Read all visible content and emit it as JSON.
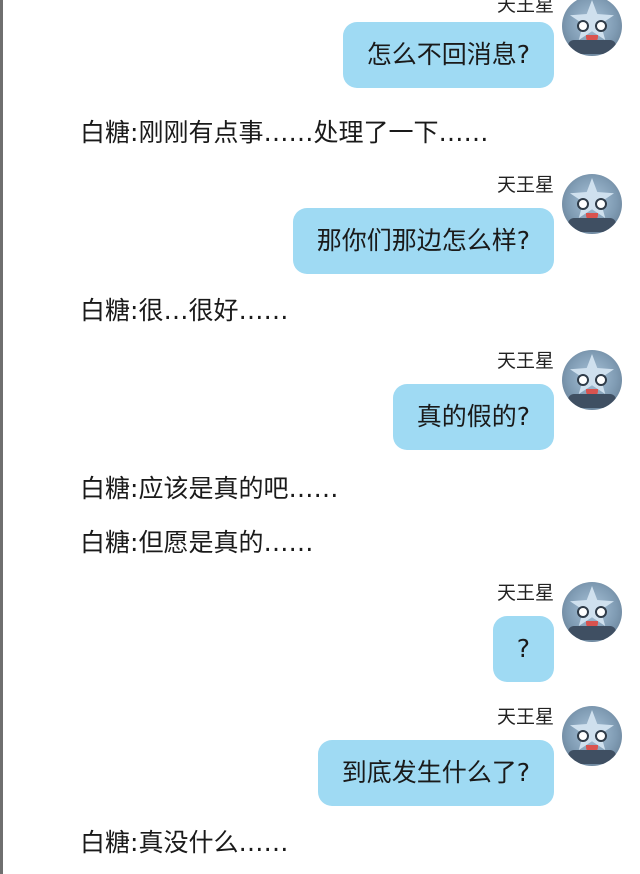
{
  "chat": {
    "messages": [
      {
        "side": "me",
        "sender": "天王星",
        "text": "怎么不回消息?"
      },
      {
        "side": "other",
        "sender": "白糖",
        "text": "刚刚有点事……处理了一下……"
      },
      {
        "side": "me",
        "sender": "天王星",
        "text": "那你们那边怎么样?"
      },
      {
        "side": "other",
        "sender": "白糖",
        "text": "很…很好……"
      },
      {
        "side": "me",
        "sender": "天王星",
        "text": "真的假的?"
      },
      {
        "side": "other",
        "sender": "白糖",
        "text": "应该是真的吧……"
      },
      {
        "side": "other",
        "sender": "白糖",
        "text": "但愿是真的……"
      },
      {
        "side": "me",
        "sender": "天王星",
        "text": "?"
      },
      {
        "side": "me",
        "sender": "天王星",
        "text": "到底发生什么了?"
      },
      {
        "side": "other",
        "sender": "白糖",
        "text": "真没什么……"
      }
    ],
    "separator": ":",
    "colors": {
      "my_bubble": "#9fdaf3",
      "background": "#ffffff"
    },
    "avatar_icon": "uranus-star-avatar-icon"
  }
}
